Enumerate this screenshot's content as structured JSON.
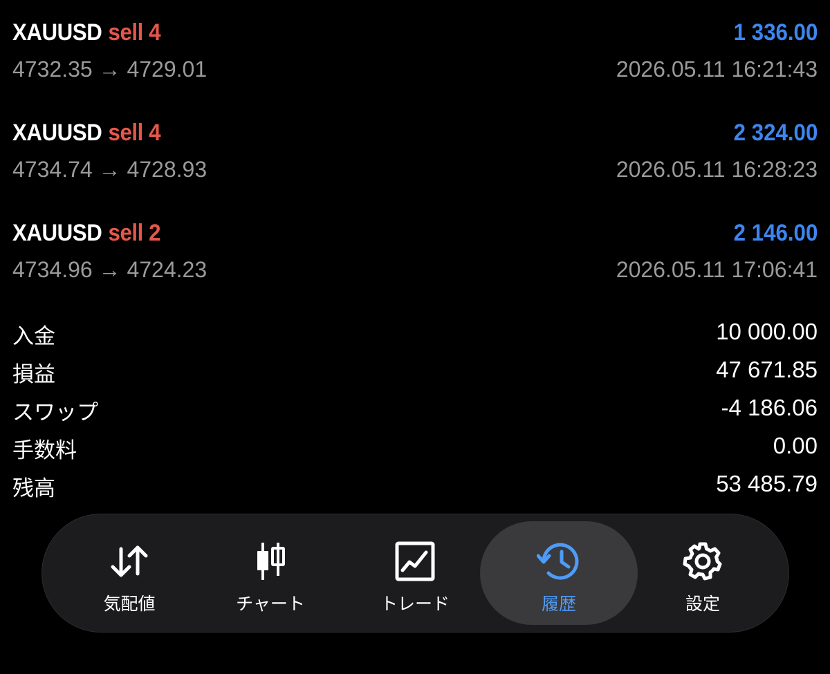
{
  "trades": [
    {
      "symbol": "XAUUSD",
      "side": "sell 4",
      "profit": "1 336.00",
      "prices": "4732.35 → 4729.01",
      "time": "2026.05.11 16:21:43"
    },
    {
      "symbol": "XAUUSD",
      "side": "sell 4",
      "profit": "2 324.00",
      "prices": "4734.74 → 4728.93",
      "time": "2026.05.11 16:28:23"
    },
    {
      "symbol": "XAUUSD",
      "side": "sell 2",
      "profit": "2 146.00",
      "prices": "4734.96 → 4724.23",
      "time": "2026.05.11 17:06:41"
    }
  ],
  "summary": {
    "deposit": {
      "label": "入金",
      "value": "10 000.00"
    },
    "profit": {
      "label": "損益",
      "value": "47 671.85"
    },
    "swap": {
      "label": "スワップ",
      "value": "-4 186.06"
    },
    "commission": {
      "label": "手数料",
      "value": "0.00"
    },
    "balance": {
      "label": "残高",
      "value": "53 485.79"
    }
  },
  "tabbar": {
    "tabs": [
      {
        "label": "気配値",
        "icon": "arrows-updown-icon",
        "active": false
      },
      {
        "label": "チャート",
        "icon": "candlestick-icon",
        "active": false
      },
      {
        "label": "トレード",
        "icon": "trade-chart-icon",
        "active": false
      },
      {
        "label": "履歴",
        "icon": "history-clock-icon",
        "active": true
      },
      {
        "label": "設定",
        "icon": "gear-icon",
        "active": false
      }
    ]
  },
  "colors": {
    "sell": "#e5574a",
    "profit": "#3d86f0",
    "active_tab": "#4f9bf5"
  }
}
